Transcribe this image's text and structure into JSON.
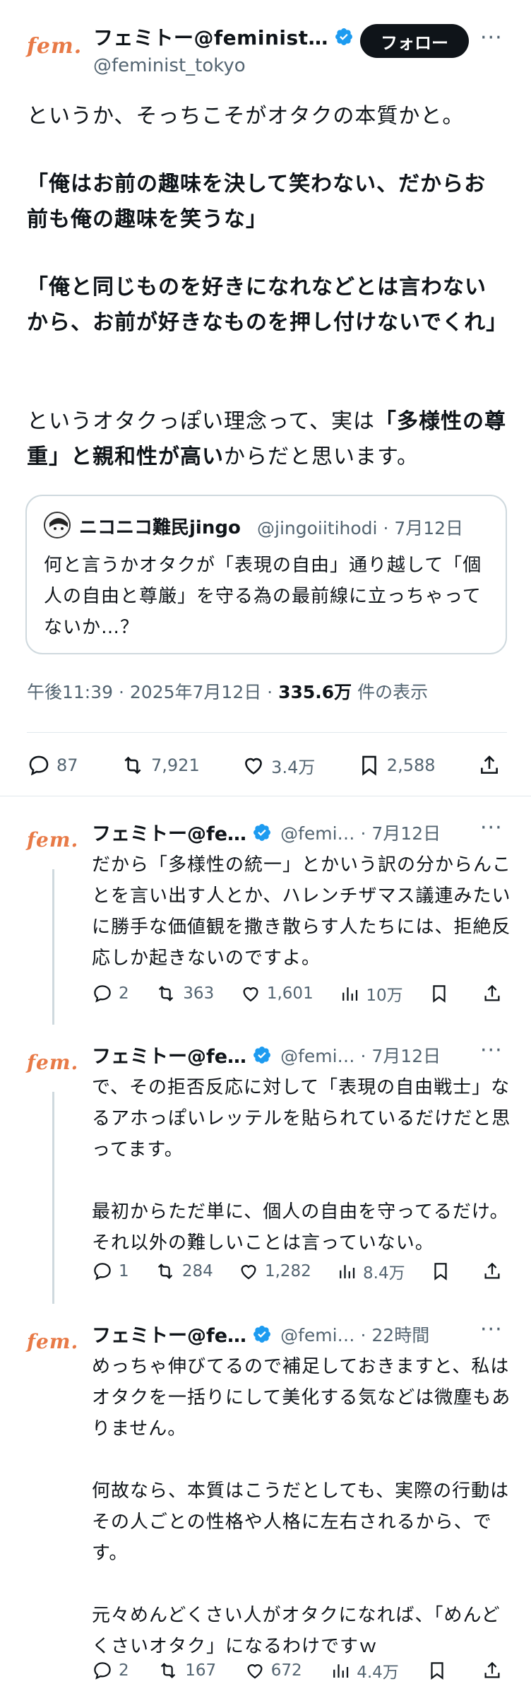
{
  "main_post": {
    "logo_text": "fem.",
    "display_name": "フェミトー@feminist…",
    "handle": "@feminist_tokyo",
    "follow_label": "フォロー",
    "more": "···",
    "paragraphs": [
      {
        "parts": [
          {
            "text": "というか、そっちこそがオタクの本質かと。",
            "bold": false
          }
        ]
      },
      {
        "parts": [
          {
            "text": "「俺はお前の趣味を決して笑わない、だからお前も俺の趣味を笑うな」",
            "bold": true
          }
        ]
      },
      {
        "parts": [
          {
            "text": "「俺と同じものを好きになれなどとは言わないから、お前が好きなものを押し付けないでくれ」",
            "bold": true
          }
        ]
      },
      {
        "parts": [
          {
            "text": "というオタクっぽい理念って、実は",
            "bold": false
          },
          {
            "text": "「多様性の尊重」と親和性が高い",
            "bold": true
          },
          {
            "text": "からだと思います。",
            "bold": false
          }
        ]
      }
    ],
    "quote": {
      "name": "ニコニコ難民jingo",
      "meta": "@jingoiitihodi · 7月12日",
      "text": "何と言うかオタクが「表現の自由」通り越して「個人の自由と尊厳」を守る為の最前線に立っちゃってないか…？"
    },
    "timestamp": "午後11:39 · 2025年7月12日 · ",
    "views": "335.6万",
    "views_suffix": " 件の表示",
    "actions": {
      "replies": "87",
      "reposts": "7,921",
      "likes": "3.4万",
      "bookmarks": "2,588"
    }
  },
  "replies": [
    {
      "logo_text": "fem.",
      "name": "フェミトー@fe…",
      "handle_time": "@femi… · 7月12日",
      "more": "···",
      "text": "だから「多様性の統一」とかいう訳の分からんことを言い出す人とか、ハレンチザマス議連みたいに勝手な価値観を撒き散らす人たちには、拒絶反応しか起きないのですよ。",
      "replies": "2",
      "reposts": "363",
      "likes": "1,601",
      "views": "10万"
    },
    {
      "logo_text": "fem.",
      "name": "フェミトー@fe…",
      "handle_time": "@femi… · 7月12日",
      "more": "···",
      "text": "で、その拒否反応に対して「表現の自由戦士」なるアホっぽいレッテルを貼られているだけだと思ってます。\n\n最初からただ単に、個人の自由を守ってるだけ。それ以外の難しいことは言っていない。",
      "replies": "1",
      "reposts": "284",
      "likes": "1,282",
      "views": "8.4万"
    },
    {
      "logo_text": "fem.",
      "name": "フェミトー@fe…",
      "handle_time": "@femi… · 22時間",
      "more": "···",
      "text": "めっちゃ伸びてるので補足しておきますと、私はオタクを一括りにして美化する気などは微塵もありません。\n\n何故なら、本質はこうだとしても、実際の行動はその人ごとの性格や人格に左右されるから、です。\n\n元々めんどくさい人がオタクになれば、「めんどくさいオタク」になるわけですｗ",
      "replies": "2",
      "reposts": "167",
      "likes": "672",
      "views": "4.4万"
    }
  ],
  "colors": {
    "brand": "#e87a47",
    "verified": "#1d9bf0",
    "text": "#0f1419",
    "muted": "#536471",
    "border": "#cfd9de"
  },
  "icons": [
    "verified-badge-icon",
    "reply-icon",
    "repost-icon",
    "like-icon",
    "views-icon",
    "bookmark-icon",
    "share-icon",
    "more-icon"
  ]
}
